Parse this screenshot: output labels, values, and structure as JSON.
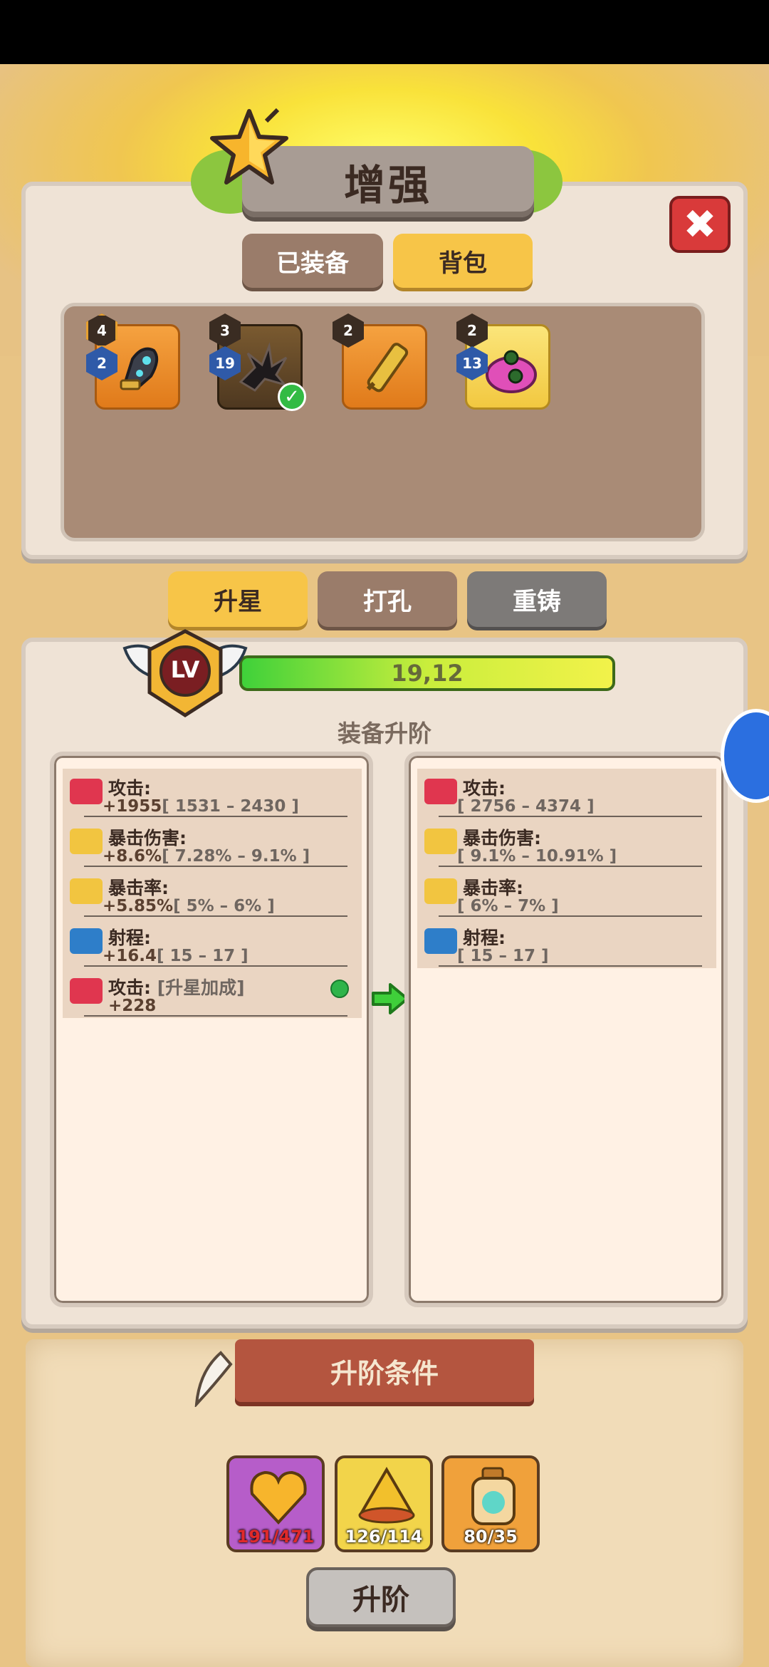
{
  "title": "增强",
  "tabs": {
    "equipped": "已装备",
    "bag": "背包"
  },
  "inventory": [
    {
      "level": "4",
      "stars": "2",
      "kind": "gauntlet",
      "equipped": false
    },
    {
      "level": "3",
      "stars": "19",
      "kind": "dark-claw",
      "equipped": true
    },
    {
      "level": "2",
      "stars": "",
      "kind": "golden-scroll",
      "equipped": false
    },
    {
      "level": "2",
      "stars": "13",
      "kind": "pink-bag",
      "equipped": false
    }
  ],
  "subtabs": {
    "star_up": "升星",
    "socket": "打孔",
    "reforge": "重铸"
  },
  "progress": {
    "badge": "LV",
    "text": "19,12",
    "fill": 1.0
  },
  "section_title": "装备升阶",
  "current_stats": [
    {
      "name": "攻击:",
      "value": "+1955",
      "range": "[ 1531 – 2430 ]",
      "icon": "attack-icon"
    },
    {
      "name": "暴击伤害:",
      "value": "+8.6%",
      "range": "[ 7.28% – 9.1% ]",
      "icon": "crit-damage-icon"
    },
    {
      "name": "暴击率:",
      "value": "+5.85%",
      "range": "[ 5% – 6% ]",
      "icon": "crit-rate-icon"
    },
    {
      "name": "射程:",
      "value": "+16.4",
      "range": "[ 15 – 17 ]",
      "icon": "range-icon"
    },
    {
      "name": "攻击:",
      "tag": "[升星加成]",
      "value": "+228",
      "range": "",
      "icon": "attack-icon"
    }
  ],
  "next_stats": [
    {
      "name": "攻击:",
      "range": "[ 2756 – 4374 ]",
      "icon": "attack-icon"
    },
    {
      "name": "暴击伤害:",
      "range": "[ 9.1% – 10.91% ]",
      "icon": "crit-damage-icon"
    },
    {
      "name": "暴击率:",
      "range": "[ 6% – 7% ]",
      "icon": "crit-rate-icon"
    },
    {
      "name": "射程:",
      "range": "[ 15 – 17 ]",
      "icon": "range-icon"
    }
  ],
  "requirements": {
    "title": "升阶条件",
    "materials": [
      {
        "count": "191/471",
        "kind": "gold-heart-gem",
        "sufficient": false
      },
      {
        "count": "126/114",
        "kind": "gold-pile",
        "sufficient": true
      },
      {
        "count": "80/35",
        "kind": "potion-bottle",
        "sufficient": true
      }
    ],
    "button": "升阶"
  },
  "colors": {
    "accent_yellow": "#f7c548",
    "insufficient": "#e02a2a",
    "close": "#d93a3a"
  }
}
